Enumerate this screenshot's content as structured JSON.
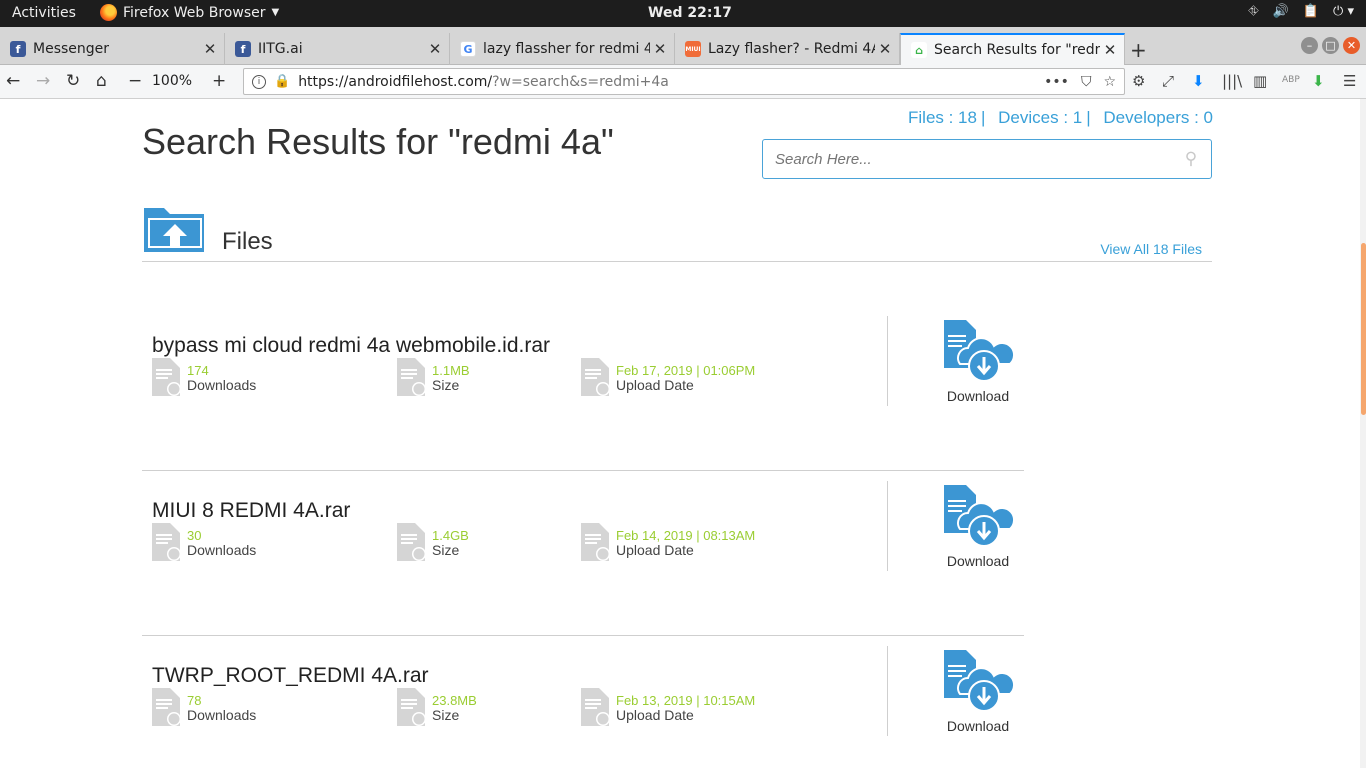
{
  "topbar": {
    "activities": "Activities",
    "app_name": "Firefox Web Browser",
    "clock": "Wed 22:17"
  },
  "tabs": [
    {
      "title": "Messenger",
      "favicon": "facebook-icon"
    },
    {
      "title": "IITG.ai",
      "favicon": "facebook-icon"
    },
    {
      "title": "lazy flassher for redmi 4a",
      "favicon": "google-icon"
    },
    {
      "title": "Lazy flasher? - Redmi 4A",
      "favicon": "miui-icon"
    },
    {
      "title": "Search Results for \"redmi",
      "favicon": "afh-icon",
      "active": true
    }
  ],
  "navbar": {
    "zoom": "100%",
    "url_host": "https://androidfilehost.com/",
    "url_path": "?w=search&s=redmi+4a"
  },
  "page": {
    "stats": {
      "files": "Files : 18",
      "devices": "Devices : 1",
      "developers": "Developers : 0",
      "sep": "|"
    },
    "heading": "Search Results for \"redmi 4a\"",
    "search_placeholder": "Search Here...",
    "files_label": "Files",
    "view_all": "View All 18 Files",
    "download_label": "Download",
    "downloads_label": "Downloads",
    "size_label": "Size",
    "upload_label": "Upload Date",
    "files": [
      {
        "name": "bypass mi cloud redmi 4a webmobile.id.rar",
        "downloads": "174",
        "size": "1.1MB",
        "date": "Feb 17, 2019 | 01:06PM"
      },
      {
        "name": "MIUI 8 REDMI 4A.rar",
        "downloads": "30",
        "size": "1.4GB",
        "date": "Feb 14, 2019 | 08:13AM"
      },
      {
        "name": "TWRP_ROOT_REDMI 4A.rar",
        "downloads": "78",
        "size": "23.8MB",
        "date": "Feb 13, 2019 | 10:15AM"
      }
    ]
  },
  "colors": {
    "accent": "#39a0d8",
    "value_green": "#9acd32",
    "tab_highlight": "#0a84ff"
  }
}
